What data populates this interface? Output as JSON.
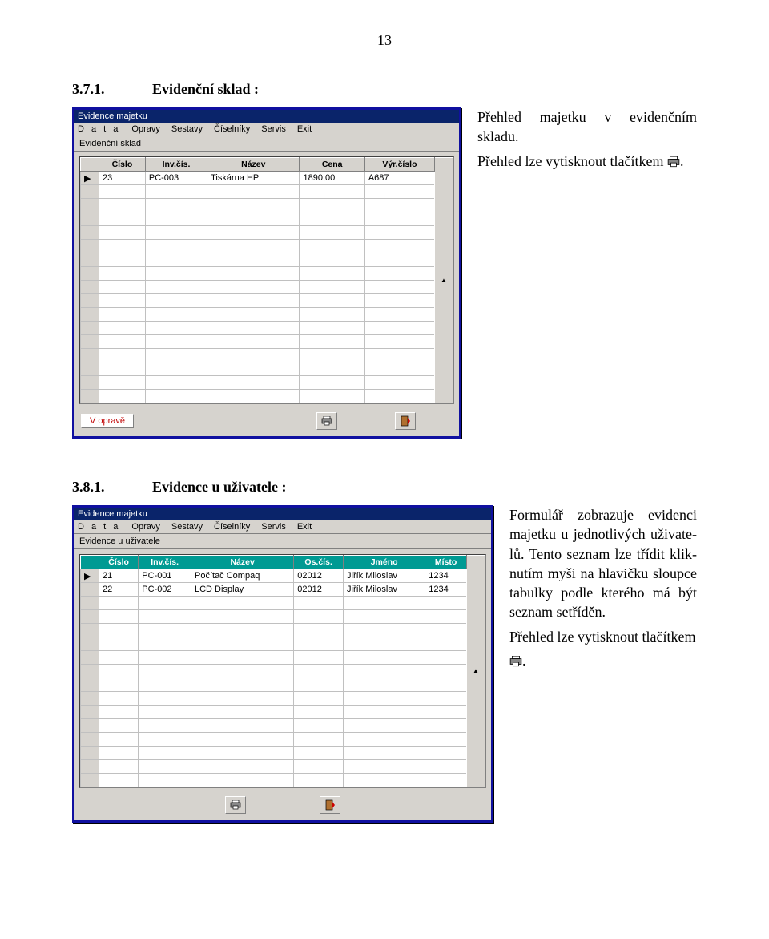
{
  "page_number": "13",
  "section_371": {
    "num": "3.7.1.",
    "title": "Evidenční sklad :",
    "caption_p1": "Přehled majetku v evidenčním skladu.",
    "caption_p2a": "Přehled lze vytisknout tlačítkem ",
    "caption_p2b": "."
  },
  "section_381": {
    "num": "3.8.1.",
    "title": "Evidence u uživatele :",
    "caption_p1": "Formulář zobrazuje evidenci majetku u jednotlivých uživate­lů. Tento seznam lze třídit klik­nutím myši na hlavičku sloupce tabulky podle kterého má být seznam setříděn.",
    "caption_p2a": "Přehled lze vytisknout tlačítkem ",
    "caption_p2b": "."
  },
  "window1": {
    "title": "Evidence majetku",
    "menu": [
      "D a t a",
      "Opravy",
      "Sestavy",
      "Číselníky",
      "Servis",
      "Exit"
    ],
    "subtitle": "Evidenční sklad",
    "headers": [
      "Číslo",
      "Inv.čís.",
      "Název",
      "Cena",
      "Výr.číslo"
    ],
    "rows": [
      [
        "23",
        "PC-003",
        "Tiskárna HP",
        "1890,00",
        "A687"
      ]
    ],
    "status": "V opravě"
  },
  "window2": {
    "title": "Evidence majetku",
    "menu": [
      "D a t a",
      "Opravy",
      "Sestavy",
      "Číselníky",
      "Servis",
      "Exit"
    ],
    "subtitle": "Evidence u uživatele",
    "headers": [
      "Číslo",
      "Inv.čís.",
      "Název",
      "Os.čís.",
      "Jméno",
      "Místo"
    ],
    "rows": [
      [
        "21",
        "PC-001",
        "Počítač Compaq",
        "02012",
        "Jiřík Miloslav",
        "1234"
      ],
      [
        "22",
        "PC-002",
        "LCD Display",
        "02012",
        "Jiřík Miloslav",
        "1234"
      ]
    ]
  },
  "icons": {
    "printer": "printer-icon",
    "door": "door-icon"
  }
}
